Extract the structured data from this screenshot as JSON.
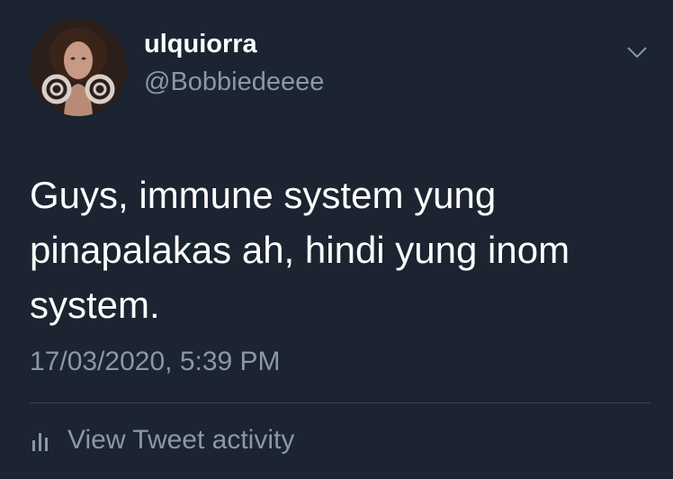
{
  "user": {
    "display_name": "ulquiorra",
    "handle": "@Bobbiedeeee",
    "avatar_icon": "profile-photo"
  },
  "tweet": {
    "text": "Guys, immune system yung\npinapalakas ah, hindi yung inom\nsystem.",
    "timestamp": "17/03/2020, 5:39 PM"
  },
  "actions": {
    "more_icon": "chevron-down-icon",
    "activity_icon": "bar-chart-icon",
    "activity_label": "View Tweet activity"
  },
  "colors": {
    "background": "#1b2430",
    "primary_text": "#ffffff",
    "secondary_text": "#8899a6",
    "divider": "#38444d"
  }
}
